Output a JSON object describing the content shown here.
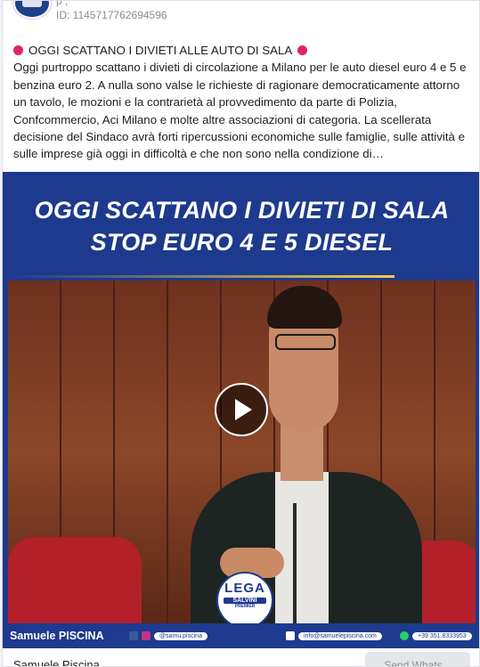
{
  "ad": {
    "top_meta": "p                     ,",
    "id_label": "ID: 1145717762694596"
  },
  "post": {
    "headline": "OGGI SCATTANO I DIVIETI ALLE AUTO DI SALA",
    "body": "Oggi purtroppo scattano i divieti di circolazione a Milano per le auto diesel euro 4 e 5 e benzina euro 2. A nulla sono valse le richieste di ragionare democraticamente attorno un tavolo, le mozioni e la contrarietà al provvedimento da parte di Polizia, Confcommercio, Aci Milano e molte altre associazioni di categoria. La scellerata decisione del Sindaco avrà forti ripercussioni economiche sulle famiglie, sulle attività e sulle imprese già oggi in difficoltà e che non sono nella condizione di…"
  },
  "media": {
    "title_line1": "OGGI SCATTANO I DIVIETI DI SALA",
    "title_line2": "STOP EURO 4 E 5 DIESEL",
    "person_name": "Samuele PISCINA",
    "social_handle": "@samu.piscina",
    "email": "info@samuelepiscina.com",
    "phone": "+39 351.8333953",
    "logo_text": "LEGA",
    "logo_subtext": "SALVINI",
    "logo_tag": "PREMIER"
  },
  "footer": {
    "advertiser_name": "Samuele Piscina",
    "cta_label": "Send Whats..."
  },
  "colors": {
    "brand_blue": "#1d3a8e",
    "accent_red": "#e0245e",
    "stripe_yellow": "#f4d03f"
  },
  "icons": {
    "headline_markers": "red-circle",
    "video": "play-icon",
    "social": [
      "facebook-icon",
      "instagram-icon"
    ],
    "contact": [
      "email-icon",
      "whatsapp-icon"
    ]
  }
}
